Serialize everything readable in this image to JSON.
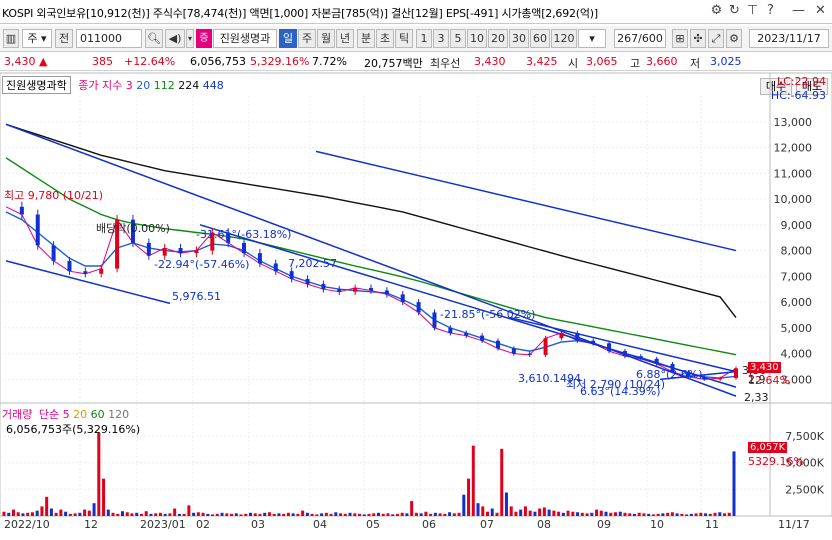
{
  "window": {
    "title": "KOSPI 외국인보유[10,912(천)] 주식수[78,474(천)] 액면[1,000] 자본금[785(억)] 결산[12월] EPS[-491] 시가총액[2,692(억)]",
    "icons": [
      "gear-icon",
      "refresh-icon",
      "pin-icon",
      "help-icon",
      "minimize-icon",
      "close-icon"
    ]
  },
  "toolbar": {
    "market": "주",
    "prev": "전",
    "code": "011000",
    "stock_name": "진원생명과",
    "periods": [
      "일",
      "주",
      "월",
      "년",
      "분",
      "초",
      "틱"
    ],
    "selected_period": "일",
    "intervals": [
      "1",
      "3",
      "5",
      "10",
      "20",
      "30",
      "60",
      "120"
    ],
    "count": "267/600",
    "date": "2023/11/17",
    "buy": "매수",
    "sell": "매도"
  },
  "quote": {
    "price": "3,430 ▲",
    "change": "385",
    "change_pct": "+12.64%",
    "volume": "6,056,753",
    "vol_pct": "5,329.16%",
    "turnover": "7.72%",
    "amount": "20,757백만",
    "best_bid_label": "최우선",
    "best_ask": "3,430",
    "best_bid": "3,425",
    "open_label": "시",
    "open": "3,065",
    "high_label": "고",
    "high": "3,660",
    "low_label": "저",
    "low": "3,025"
  },
  "price_panel": {
    "stock_label": "진원생명과학",
    "ma_label": "종가 지수",
    "ma_values": [
      "3",
      "20",
      "112",
      "224",
      "448"
    ],
    "lc": "LC:22.94",
    "hc": "HC:-64.93",
    "current_price_tag": "3,430",
    "current_pct_tag": "12.64%",
    "line_value_a": "3,30",
    "line_value_b": "2,9",
    "line_value_c": "2,33",
    "annotations": {
      "high": "최고 9,780 (10/21)",
      "dividend": "배당락(0.00%)",
      "ann1": "-31.61°(-63.18%)",
      "ann2": "-22.94°(-57.46%)",
      "ann3": "7,202.57",
      "ann4": "5,976.51",
      "ann5": "-21.85°(-56.02%)",
      "ann6": "3,610.1494",
      "ann7": "최저 2,790 (10/24)",
      "ann8": "6.88°(2.6%)",
      "ann9": "6.63°(14.39%)"
    }
  },
  "volume_panel": {
    "label": "거래량",
    "ma_label": "단순",
    "ma_values": [
      "5",
      "20",
      "60",
      "120"
    ],
    "info": "6,056,753주(5,329.16%)",
    "current_tag": "6,057K",
    "current_pct": "5329.16%"
  },
  "x_axis": [
    "2022/10",
    "12",
    "2023/01",
    "02",
    "03",
    "04",
    "05",
    "06",
    "07",
    "08",
    "09",
    "10",
    "11",
    "11/17"
  ],
  "chart_data": [
    {
      "type": "line",
      "title": "",
      "x_axis_labels": [
        "2022/10",
        "12",
        "2023/01",
        "02",
        "03",
        "04",
        "05",
        "06",
        "07",
        "08",
        "09",
        "10",
        "11"
      ],
      "y_ticks": [
        3000,
        4000,
        5000,
        6000,
        7000,
        8000,
        9000,
        10000,
        11000,
        12000,
        13000
      ],
      "y_tick_labels": [
        "3,000",
        "4,000",
        "5,000",
        "6,000",
        "7,000",
        "8,000",
        "9,000",
        "10,000",
        "11,000",
        "12,000",
        "13,000"
      ],
      "ylim": [
        2200,
        14000
      ],
      "series": [
        {
          "name": "3",
          "color": "#e6007e",
          "values": [
            9700,
            9400,
            8200,
            7600,
            7200,
            7100,
            7300,
            9200,
            8300,
            7800,
            8100,
            7900,
            8000,
            8700,
            8300,
            7900,
            7500,
            7200,
            6900,
            6700,
            6500,
            6400,
            6550,
            6450,
            6300,
            6000,
            5600,
            5000,
            4800,
            4700,
            4500,
            4200,
            4000,
            3950,
            4600,
            4800,
            4500,
            4400,
            4100,
            3900,
            3800,
            3600,
            3300,
            3100,
            3000,
            3050,
            3430
          ]
        },
        {
          "name": "20",
          "color": "#1b5fd9",
          "values": [
            9500,
            9200,
            8700,
            8200,
            7700,
            7400,
            7400,
            8100,
            8300,
            8100,
            8000,
            7950,
            8000,
            8250,
            8200,
            8000,
            7600,
            7300,
            7000,
            6800,
            6600,
            6500,
            6450,
            6400,
            6350,
            6100,
            5800,
            5300,
            5000,
            4800,
            4600,
            4400,
            4200,
            4100,
            4250,
            4450,
            4500,
            4400,
            4200,
            4000,
            3850,
            3650,
            3450,
            3250,
            3100,
            3050,
            3120
          ]
        },
        {
          "name": "112",
          "color": "#0b8a12",
          "values": [
            11600,
            11200,
            10800,
            10400,
            10000,
            9700,
            9400,
            9200,
            9050,
            8950,
            8850,
            8780,
            8700,
            8630,
            8550,
            8450,
            8300,
            8150,
            8000,
            7850,
            7700,
            7550,
            7400,
            7260,
            7120,
            6980,
            6820,
            6640,
            6460,
            6280,
            6100,
            5920,
            5740,
            5570,
            5400,
            5280,
            5160,
            5040,
            4920,
            4800,
            4680,
            4560,
            4440,
            4320,
            4200,
            4080,
            3960
          ]
        },
        {
          "name": "224",
          "color": "#111111",
          "values": [
            12900,
            12700,
            12500,
            12300,
            12100,
            11900,
            11700,
            11550,
            11400,
            11250,
            11100,
            11000,
            10900,
            10800,
            10700,
            10600,
            10500,
            10400,
            10300,
            10200,
            10100,
            9980,
            9860,
            9740,
            9620,
            9500,
            9330,
            9160,
            8990,
            8820,
            8650,
            8480,
            8310,
            8140,
            7970,
            7800,
            7640,
            7480,
            7320,
            7160,
            7000,
            6840,
            6680,
            6520,
            6360,
            6200,
            5400
          ]
        }
      ]
    },
    {
      "type": "bar",
      "title": "",
      "x_axis_labels": [
        "2022/10",
        "12",
        "2023/01",
        "02",
        "03",
        "04",
        "05",
        "06",
        "07",
        "08",
        "09",
        "10",
        "11"
      ],
      "y_ticks": [
        2500,
        5000,
        7500
      ],
      "y_tick_labels": [
        "2,500K",
        "5,000K",
        "7,500K"
      ],
      "ylim": [
        0,
        9000
      ],
      "series": [
        {
          "name": "거래량",
          "unit": "K",
          "values": [
            400,
            300,
            600,
            350,
            250,
            300,
            350,
            500,
            900,
            1800,
            700,
            300,
            600,
            400,
            200,
            250,
            300,
            600,
            500,
            1200,
            7800,
            3500,
            600,
            300,
            200,
            450,
            350,
            250,
            300,
            200,
            450,
            200,
            250,
            300,
            200,
            250,
            700,
            200,
            200,
            1000,
            300,
            350,
            300,
            200,
            150,
            200,
            300,
            250,
            200,
            250,
            150,
            200,
            300,
            250,
            200,
            300,
            350,
            200,
            250,
            200,
            300,
            250,
            200,
            500,
            300,
            200,
            150,
            250,
            300,
            200,
            350,
            250,
            200,
            300,
            250,
            200,
            150,
            200,
            250,
            300,
            200,
            250,
            150,
            200,
            300,
            250,
            1400,
            300,
            250,
            400,
            200,
            300,
            250,
            200,
            350,
            250,
            300,
            2000,
            3500,
            6600,
            1200,
            900,
            400,
            700,
            300,
            6300,
            2200,
            900,
            400,
            600,
            900,
            500,
            400,
            700,
            800,
            600,
            500,
            400,
            300,
            500,
            400,
            350,
            300,
            250,
            300,
            600,
            500,
            400,
            300,
            350,
            400,
            300,
            250,
            200,
            300,
            250,
            200,
            150,
            200,
            250,
            300,
            350,
            250,
            200,
            150,
            200,
            250,
            300,
            250,
            200,
            300,
            350,
            250,
            300,
            6057
          ]
        }
      ]
    }
  ]
}
